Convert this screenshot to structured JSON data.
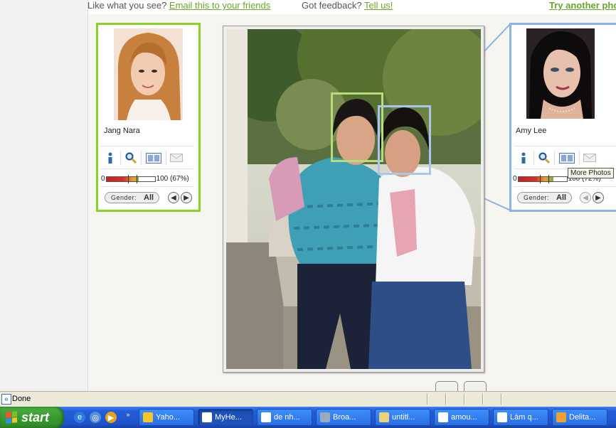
{
  "header": {
    "like_text": "Like what you see?",
    "email_link": "Email this to your friends",
    "feedback_text": "Got feedback?",
    "tell_link": "Tell us!",
    "try_link": "Try another phot"
  },
  "left_match": {
    "name": "Jang Nara",
    "score_min": "0",
    "score_label": "100 (67%)",
    "score_fraction": 0.67,
    "gender_label": "Gender:",
    "gender_value": "All",
    "accent": "#8cd12a"
  },
  "right_match": {
    "name": "Amy Lee",
    "score_min": "0",
    "score_label": "100 (72%)",
    "score_fraction": 0.72,
    "gender_label": "Gender:",
    "gender_value": "All",
    "accent": "#8db4e6",
    "tooltip": "More Photos"
  },
  "tools": [
    "info-icon",
    "magnify-icon",
    "more-photos-icon",
    "email-icon"
  ],
  "status": {
    "text": "Done"
  },
  "taskbar": {
    "start_label": "start",
    "buttons": [
      {
        "label": "Yaho...",
        "icon": "smiley-icon"
      },
      {
        "label": "MyHe...",
        "icon": "ie-window-icon",
        "active": true
      },
      {
        "label": "de nh...",
        "icon": "ie-window-icon"
      },
      {
        "label": "Broa...",
        "icon": "globe-icon"
      },
      {
        "label": "untitl...",
        "icon": "paint-icon"
      },
      {
        "label": "amou...",
        "icon": "ie-window-icon"
      },
      {
        "label": "Làm q...",
        "icon": "ie-window-icon"
      },
      {
        "label": "Delita...",
        "icon": "gear-icon"
      }
    ]
  }
}
